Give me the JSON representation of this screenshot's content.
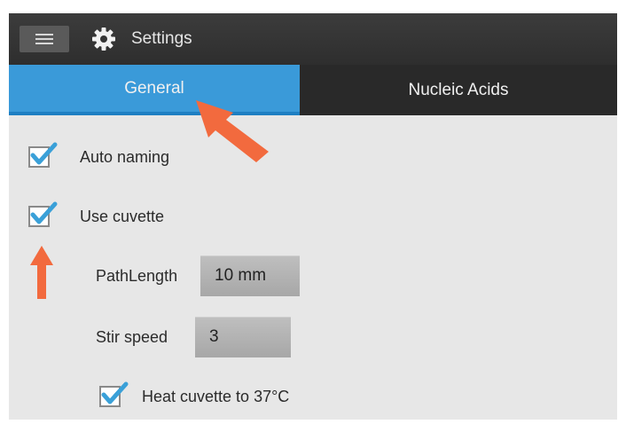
{
  "header": {
    "title": "Settings",
    "menu_icon": "hamburger-menu-icon",
    "settings_icon": "gear-icon"
  },
  "tabs": [
    {
      "label": "General",
      "active": true
    },
    {
      "label": "Nucleic Acids",
      "active": false
    }
  ],
  "general": {
    "auto_naming": {
      "label": "Auto naming",
      "checked": true
    },
    "use_cuvette": {
      "label": "Use cuvette",
      "checked": true
    },
    "path_length": {
      "label": "PathLength",
      "value": "10 mm"
    },
    "stir_speed": {
      "label": "Stir speed",
      "value": "3"
    },
    "heat_cuvette": {
      "label": "Heat cuvette to 37°C",
      "checked": true
    }
  },
  "colors": {
    "tab_active": "#3a9ad9",
    "checkmark": "#3aa0d8",
    "annotation_arrow": "#f26a3e"
  },
  "annotations": {
    "arrow_icon_1": "orange-arrow-icon",
    "arrow_icon_2": "orange-arrow-icon"
  }
}
